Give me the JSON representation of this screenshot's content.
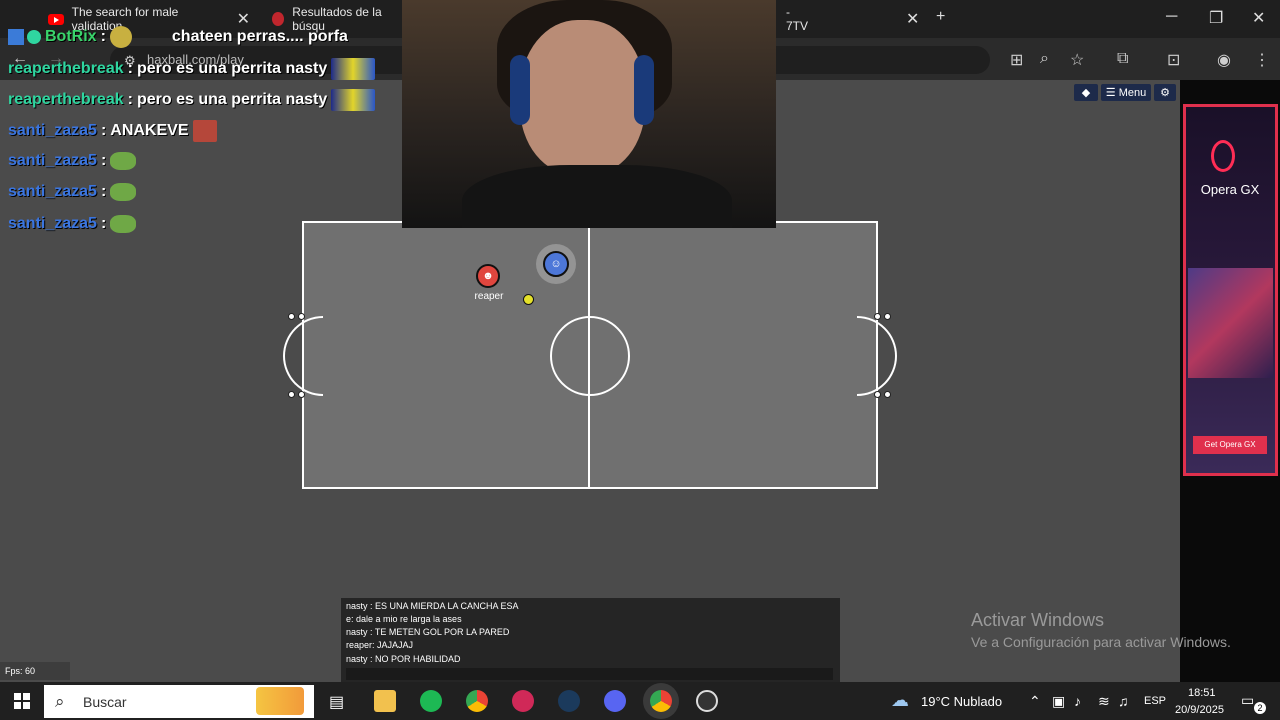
{
  "browser": {
    "tabs": [
      {
        "title": "The search for male validation"
      },
      {
        "title": "Resultados de la búsqu"
      },
      {
        "title": "- 7TV"
      }
    ],
    "new_tab_glyph": "+",
    "close_glyph": "✕",
    "url": "haxball.com/play",
    "window_controls": [
      "─",
      "❐",
      "✕"
    ]
  },
  "stream_chat": [
    {
      "user": "BotRix",
      "sep": ":",
      "message": "chateen perras.... porfa"
    },
    {
      "user": "reaperthebreak",
      "sep": ":",
      "message": "pero es una perrita nasty"
    },
    {
      "user": "reaperthebreak",
      "sep": ":",
      "message": "pero es una perrita nasty"
    },
    {
      "user": "santi_zaza5",
      "sep": ":",
      "message": "ANAKEVE"
    },
    {
      "user": "santi_zaza5",
      "sep": ":",
      "message": ""
    },
    {
      "user": "santi_zaza5",
      "sep": ":",
      "message": ""
    },
    {
      "user": "santi_zaza5",
      "sep": ":",
      "message": ""
    }
  ],
  "game": {
    "menu_label": "☰ Menu",
    "player_red_name": "reaper",
    "fps": "Fps: 60",
    "chat": [
      "nasty : ES UNA MIERDA LA CANCHA ESA",
      "e: dale a mio re larga la ases",
      "nasty : TE METEN GOL POR LA PARED",
      "reaper: JAJAJAJ",
      "nasty : NO POR HABILIDAD"
    ]
  },
  "ad": {
    "title": "Opera GX",
    "button": "Get Opera GX"
  },
  "watermark": {
    "line1": "Activar Windows",
    "line2": "Ve a Configuración para activar Windows."
  },
  "taskbar": {
    "search_placeholder": "Buscar",
    "weather": "19°C  Nublado",
    "lang": "ESP",
    "time": "18:51",
    "date": "20/9/2025",
    "notif_count": "2"
  },
  "colors": {
    "user_green": "#2fd6a0",
    "user_blue": "#3a75e0",
    "red_team": "#e0463e",
    "blue_team": "#4d77d8",
    "ball": "#e5e12a",
    "ad_accent": "#e0304d"
  }
}
